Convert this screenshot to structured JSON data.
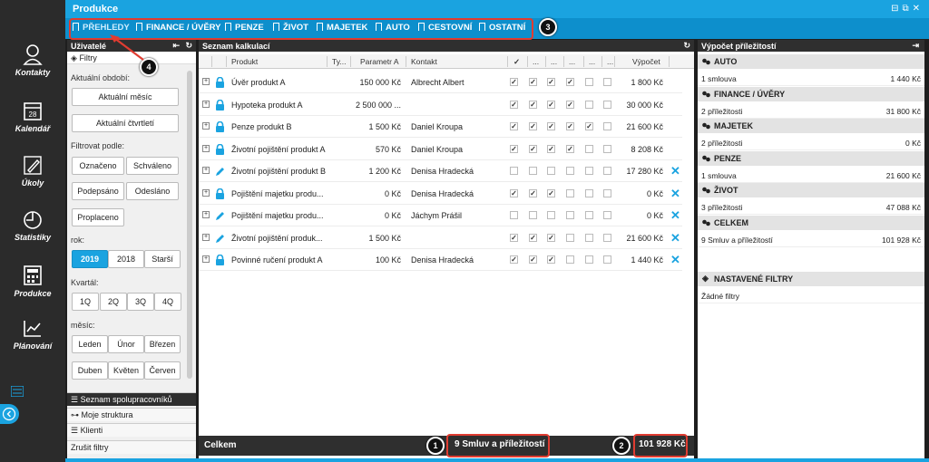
{
  "nav": [
    {
      "label": "Kontakty",
      "icon": "person-icon"
    },
    {
      "label": "Kalendář",
      "icon": "calendar-icon",
      "day": "28"
    },
    {
      "label": "Úkoly",
      "icon": "pencil-icon"
    },
    {
      "label": "Statistiky",
      "icon": "clock-icon"
    },
    {
      "label": "Produkce",
      "icon": "calculator-icon"
    },
    {
      "label": "Plánování",
      "icon": "chart-icon"
    }
  ],
  "header": {
    "title": "Produkce"
  },
  "tabs": [
    "PŘEHLEDY",
    "FINANCE / ÚVĚRY",
    "PENZE",
    "ŽIVOT",
    "MAJETEK",
    "AUTO",
    "CESTOVNÍ",
    "OSTATNÍ"
  ],
  "users": {
    "title": "Uživatelé",
    "filters_label": "Filtry",
    "period_label": "Aktuální období:",
    "current_month": "Aktuální měsíc",
    "current_quarter": "Aktuální čtvrtletí",
    "filter_by_label": "Filtrovat podle:",
    "status_buttons": [
      "Označeno",
      "Schváleno",
      "Podepsáno",
      "Odesláno",
      "Proplaceno"
    ],
    "year_label": "rok:",
    "years": [
      "2019",
      "2018",
      "Starší"
    ],
    "quarter_label": "Kvartál:",
    "quarters": [
      "1Q",
      "2Q",
      "3Q",
      "4Q"
    ],
    "month_label": "měsíc:",
    "months": [
      "Leden",
      "Únor",
      "Březen",
      "Duben",
      "Květen",
      "Červen"
    ],
    "footer": [
      "Seznam spolupracovníků",
      "Moje struktura",
      "Klienti",
      "Zrušit filtry"
    ]
  },
  "calc": {
    "title": "Seznam kalkulací",
    "columns": {
      "product": "Produkt",
      "type": "Ty...",
      "param": "Parametr A",
      "contact": "Kontakt",
      "check": "✓",
      "ellipsis": "...",
      "price": "Výpočet"
    },
    "rows": [
      {
        "icon": "lock",
        "product": "Úvěr produkt A",
        "param": "150 000 Kč",
        "contact": "Albrecht Albert",
        "checks": [
          1,
          1,
          1,
          1,
          0,
          0
        ],
        "price": "1 800 Kč",
        "del": ""
      },
      {
        "icon": "lock",
        "product": "Hypoteka produkt A",
        "param": "2 500 000 ...",
        "contact": "",
        "checks": [
          1,
          1,
          1,
          1,
          0,
          0
        ],
        "price": "30 000 Kč",
        "del": ""
      },
      {
        "icon": "lock",
        "product": "Penze produkt B",
        "param": "1 500 Kč",
        "contact": "Daniel Kroupa",
        "checks": [
          1,
          1,
          1,
          1,
          1,
          0
        ],
        "price": "21 600 Kč",
        "del": ""
      },
      {
        "icon": "lock",
        "product": "Životní pojištění produkt A",
        "param": "570 Kč",
        "contact": "Daniel Kroupa",
        "checks": [
          1,
          1,
          1,
          1,
          0,
          0
        ],
        "price": "8 208 Kč",
        "del": ""
      },
      {
        "icon": "pencil",
        "product": "Životní pojištění produkt B",
        "param": "1 200 Kč",
        "contact": "Denisa Hradecká",
        "checks": [
          0,
          0,
          0,
          0,
          0,
          0
        ],
        "price": "17 280 Kč",
        "del": "✕"
      },
      {
        "icon": "lock",
        "product": "Pojištění majetku produ...",
        "param": "0 Kč",
        "contact": "Denisa Hradecká",
        "checks": [
          1,
          1,
          1,
          0,
          0,
          0
        ],
        "price": "0 Kč",
        "del": "✕"
      },
      {
        "icon": "pencil",
        "product": "Pojištění majetku produ...",
        "param": "0 Kč",
        "contact": "Jáchym Prášil",
        "checks": [
          0,
          0,
          0,
          0,
          0,
          0
        ],
        "price": "0 Kč",
        "del": "✕"
      },
      {
        "icon": "pencil",
        "product": "Životní pojištění produk...",
        "param": "1 500 Kč",
        "contact": "",
        "checks": [
          1,
          1,
          1,
          0,
          0,
          0
        ],
        "price": "21 600 Kč",
        "del": "✕"
      },
      {
        "icon": "lock",
        "product": "Povinné ručení produkt A",
        "param": "100 Kč",
        "contact": "Denisa Hradecká",
        "checks": [
          1,
          1,
          1,
          0,
          0,
          0
        ],
        "price": "1 440 Kč",
        "del": "✕"
      }
    ],
    "footer": {
      "label": "Celkem",
      "count": "9 Smluv a příležitostí",
      "total": "101 928 Kč"
    }
  },
  "opp": {
    "title": "Výpočet příležitostí",
    "sections": [
      {
        "name": "AUTO",
        "left": "1 smlouva",
        "right": "1 440 Kč"
      },
      {
        "name": "FINANCE / ÚVĚRY",
        "left": "2 příležitosti",
        "right": "31 800 Kč"
      },
      {
        "name": "MAJETEK",
        "left": "2 příležitosti",
        "right": "0 Kč"
      },
      {
        "name": "PENZE",
        "left": "1 smlouva",
        "right": "21 600 Kč"
      },
      {
        "name": "ŽIVOT",
        "left": "3 příležitosti",
        "right": "47 088 Kč"
      },
      {
        "name": "CELKEM",
        "left": "9 Smluv a příležitostí",
        "right": "101 928 Kč"
      }
    ],
    "filters_title": "NASTAVENÉ FILTRY",
    "filters_value": "Žádné filtry"
  },
  "badges": [
    "1",
    "2",
    "3",
    "4"
  ],
  "colors": {
    "accent": "#1aa3e0",
    "highlight": "#e03c31",
    "dark": "#2f2f2f"
  }
}
